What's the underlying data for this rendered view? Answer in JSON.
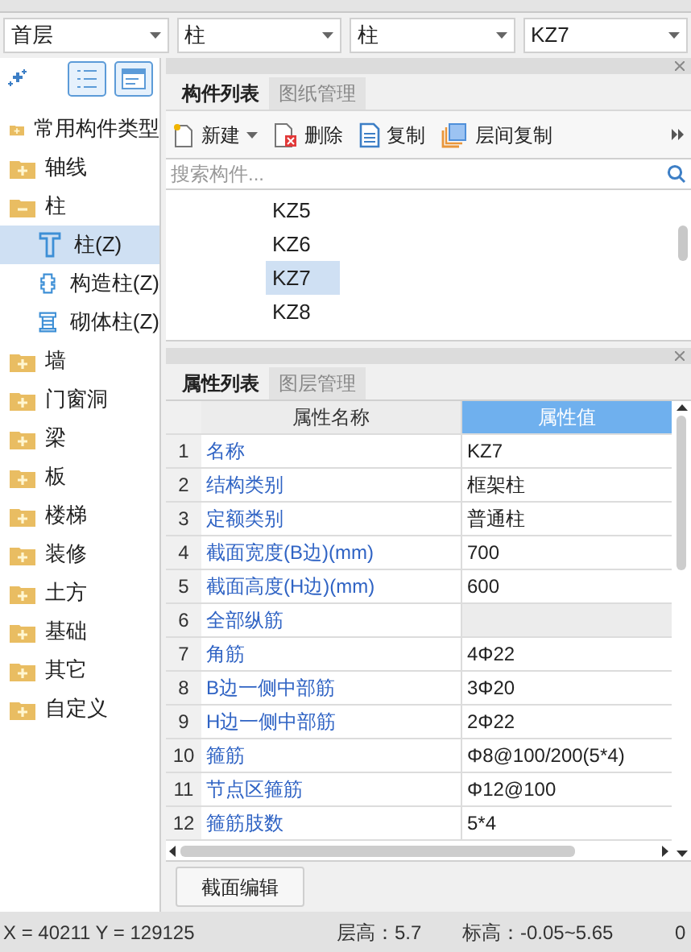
{
  "top_dropdowns": [
    {
      "value": "首层"
    },
    {
      "value": "柱"
    },
    {
      "value": "柱"
    },
    {
      "value": "KZ7"
    }
  ],
  "sidebar": {
    "items": [
      {
        "label": "常用构件类型",
        "expanded": false
      },
      {
        "label": "轴线",
        "expanded": false
      },
      {
        "label": "柱",
        "expanded": true,
        "children": [
          {
            "label": "柱(Z)",
            "kind": "column",
            "selected": true
          },
          {
            "label": "构造柱(Z)",
            "kind": "constructional",
            "selected": false
          },
          {
            "label": "砌体柱(Z)",
            "kind": "masonry",
            "selected": false
          }
        ]
      },
      {
        "label": "墙",
        "expanded": false
      },
      {
        "label": "门窗洞",
        "expanded": false
      },
      {
        "label": "梁",
        "expanded": false
      },
      {
        "label": "板",
        "expanded": false
      },
      {
        "label": "楼梯",
        "expanded": false
      },
      {
        "label": "装修",
        "expanded": false
      },
      {
        "label": "土方",
        "expanded": false
      },
      {
        "label": "基础",
        "expanded": false
      },
      {
        "label": "其它",
        "expanded": false
      },
      {
        "label": "自定义",
        "expanded": false
      }
    ]
  },
  "component_panel": {
    "tabs": [
      {
        "label": "构件列表",
        "selected": true
      },
      {
        "label": "图纸管理",
        "selected": false
      }
    ],
    "toolbar": [
      {
        "label": "新建",
        "kind": "new"
      },
      {
        "label": "删除",
        "kind": "delete"
      },
      {
        "label": "复制",
        "kind": "copy"
      },
      {
        "label": "层间复制",
        "kind": "floor_copy"
      }
    ],
    "search": {
      "placeholder": "搜索构件..."
    },
    "items": [
      {
        "label": "KZ5",
        "selected": false
      },
      {
        "label": "KZ6",
        "selected": false
      },
      {
        "label": "KZ7",
        "selected": true
      },
      {
        "label": "KZ8",
        "selected": false
      }
    ]
  },
  "property_panel": {
    "tabs": [
      {
        "label": "属性列表",
        "selected": true
      },
      {
        "label": "图层管理",
        "selected": false
      }
    ],
    "columns": [
      "属性名称",
      "属性值"
    ],
    "rows": [
      {
        "index": "1",
        "name": "名称",
        "value": "KZ7",
        "kind": "property"
      },
      {
        "index": "2",
        "name": "结构类别",
        "value": "框架柱",
        "kind": "property"
      },
      {
        "index": "3",
        "name": "定额类别",
        "value": "普通柱",
        "kind": "property"
      },
      {
        "index": "4",
        "name": "截面宽度(B边)(mm)",
        "value": "700",
        "kind": "property"
      },
      {
        "index": "5",
        "name": "截面高度(H边)(mm)",
        "value": "600",
        "kind": "property"
      },
      {
        "index": "6",
        "name": "全部纵筋",
        "kind": "group"
      },
      {
        "index": "7",
        "name": "角筋",
        "value": "4Φ22",
        "kind": "property"
      },
      {
        "index": "8",
        "name": "B边一侧中部筋",
        "value": "3Φ20",
        "kind": "property"
      },
      {
        "index": "9",
        "name": "H边一侧中部筋",
        "value": "2Φ22",
        "kind": "property"
      },
      {
        "index": "10",
        "name": "箍筋",
        "value": "Φ8@100/200(5*4)",
        "kind": "property"
      },
      {
        "index": "11",
        "name": "节点区箍筋",
        "value": "Φ12@100",
        "kind": "property"
      },
      {
        "index": "12",
        "name": "箍筋肢数",
        "value": "5*4",
        "kind": "property"
      }
    ],
    "button": "截面编辑"
  },
  "status_bar": {
    "coordinates": "X = 40211 Y = 129125",
    "floor_height": "层高：5.7",
    "elevation": "标高：-0.05~5.65",
    "extra": "0"
  }
}
